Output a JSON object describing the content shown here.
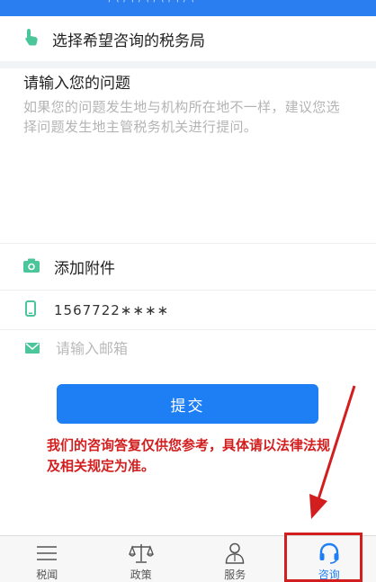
{
  "tax_bureau": {
    "label": "选择希望咨询的税务局",
    "icon": "pointing-hand-icon"
  },
  "question": {
    "title": "请输入您的问题",
    "hint": "如果您的问题发生地与机构所在地不一样，建议您选择问题发生地主管税务机关进行提问。"
  },
  "attachment": {
    "label": "添加附件",
    "icon": "camera-icon"
  },
  "phone": {
    "value": "1567722∗∗∗∗",
    "icon": "phone-icon"
  },
  "email": {
    "placeholder": "请输入邮箱",
    "icon": "mail-icon"
  },
  "submit": {
    "label": "提交"
  },
  "disclaimer": "我们的咨询答复仅供您参考，具体请以法律法规及相关规定为准。",
  "tabbar": {
    "items": [
      {
        "label": "税闻",
        "icon": "news-lines-icon",
        "active": false
      },
      {
        "label": "政策",
        "icon": "scales-icon",
        "active": false
      },
      {
        "label": "服务",
        "icon": "person-icon",
        "active": false
      },
      {
        "label": "咨询",
        "icon": "headset-icon",
        "active": true
      }
    ]
  },
  "colors": {
    "accent": "#1e7ef3",
    "annotation": "#d21e1e",
    "icon_green": "#4bc59a"
  }
}
